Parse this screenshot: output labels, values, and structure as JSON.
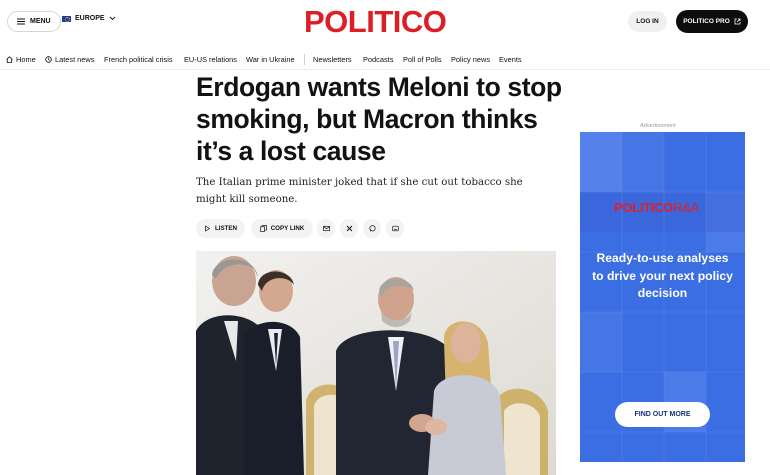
{
  "header": {
    "menu_label": "MENU",
    "edition_label": "EUROPE",
    "logo_text": "POLITICO",
    "login_label": "LOG IN",
    "pro_label": "POLITICO PRO"
  },
  "nav": {
    "items": [
      "Home",
      "Latest news",
      "French political crisis",
      "EU-US relations",
      "War in Ukraine",
      "Newsletters",
      "Podcasts",
      "Poll of Polls",
      "Policy news",
      "Events"
    ]
  },
  "article": {
    "headline": "Erdogan wants Meloni to stop smoking, but Macron thinks it’s a lost cause",
    "dek": "The Italian prime minister joked that if she cut out tobacco she might kill someone.",
    "listen_label": "LISTEN",
    "copy_link_label": "COPY LINK"
  },
  "ad": {
    "label": "Advertisement",
    "brand_main": "POLITICO",
    "brand_suffix": "R&A",
    "text": "Ready-to-use analyses to drive your next policy decision",
    "cta": "FIND OUT MORE"
  },
  "colors": {
    "brand_red": "#dc1f26",
    "ad_blue": "#3b6de3",
    "pro_button": "#0d0d0d"
  }
}
